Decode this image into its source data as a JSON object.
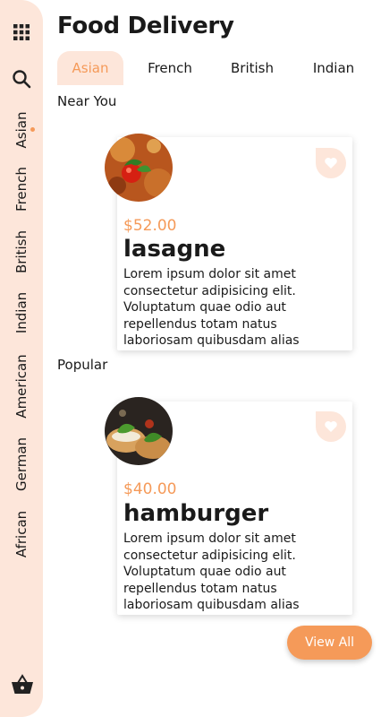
{
  "app": {
    "title": "Food Delivery"
  },
  "sidebar": {
    "icons": [
      "grid-icon",
      "search-icon",
      "basket-icon"
    ],
    "items": [
      {
        "label": "Asian"
      },
      {
        "label": "French"
      },
      {
        "label": "British"
      },
      {
        "label": "Indian"
      },
      {
        "label": "American"
      },
      {
        "label": "German"
      },
      {
        "label": "African"
      }
    ]
  },
  "tabs": [
    {
      "label": "Asian"
    },
    {
      "label": "French"
    },
    {
      "label": "British"
    },
    {
      "label": "Indian"
    }
  ],
  "sections": {
    "near": "Near You",
    "popular": "Popular"
  },
  "items": [
    {
      "price": "$52.00",
      "name": "lasagne",
      "description": "Lorem ipsum dolor sit amet consectetur adipisicing elit. Voluptatum quae odio aut repellendus totam natus laboriosam quibusdam alias"
    },
    {
      "price": "$40.00",
      "name": "hamburger",
      "description": "Lorem ipsum dolor sit amet consectetur adipisicing elit. Voluptatum quae odio aut repellendus totam natus laboriosam quibusdam alias"
    }
  ],
  "actions": {
    "view_all": "View All"
  },
  "colors": {
    "accent": "#f59a59",
    "accent_light": "#fde6da"
  }
}
